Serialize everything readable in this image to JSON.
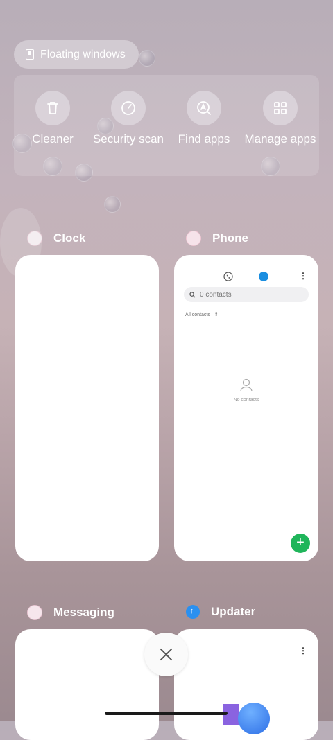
{
  "floating_windows": {
    "label": "Floating windows"
  },
  "tools": [
    {
      "label": "Cleaner",
      "icon": "trash-icon"
    },
    {
      "label": "Security scan",
      "icon": "gauge-icon"
    },
    {
      "label": "Find apps",
      "icon": "find-apps-icon"
    },
    {
      "label": "Manage apps",
      "icon": "grid-icon"
    }
  ],
  "apps": [
    {
      "name": "Clock"
    },
    {
      "name": "Phone"
    },
    {
      "name": "Messaging"
    },
    {
      "name": "Updater"
    }
  ],
  "phone_preview": {
    "search_placeholder": "0 contacts",
    "filter_label": "All contacts",
    "empty_label": "No contacts"
  },
  "colors": {
    "fab_green": "#1fb55a",
    "contacts_blue": "#1a8ee0",
    "updater_blue": "#2a90f0"
  }
}
